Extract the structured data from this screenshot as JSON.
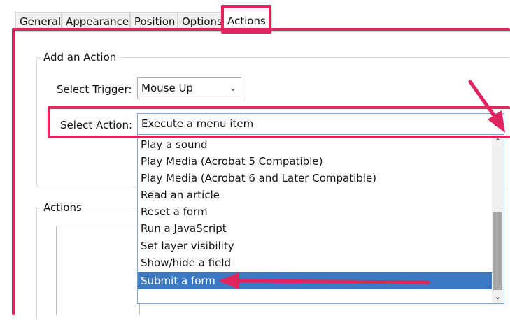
{
  "tabs": [
    "General",
    "Appearance",
    "Position",
    "Options",
    "Actions"
  ],
  "add_action": {
    "legend": "Add an Action",
    "trigger_label": "Select Trigger:",
    "trigger_value": "Mouse Up",
    "action_label": "Select Action:",
    "action_value": "Execute a menu item"
  },
  "actions_group": {
    "legend": "Actions"
  },
  "dropdown": {
    "items": [
      "Play a sound",
      "Play Media (Acrobat 5 Compatible)",
      "Play Media (Acrobat 6 and Later Compatible)",
      "Read an article",
      "Reset a form",
      "Run a JavaScript",
      "Set layer visibility",
      "Show/hide a field",
      "Submit a form"
    ],
    "selected": "Submit a form"
  },
  "colors": {
    "highlight": "#e0245e",
    "selection": "#3b79c4"
  }
}
